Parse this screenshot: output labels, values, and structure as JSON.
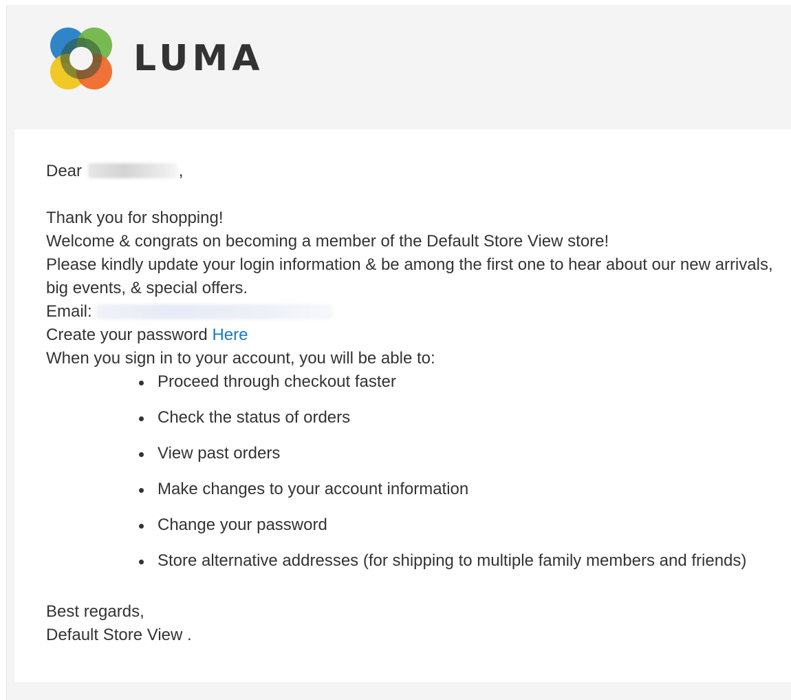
{
  "header": {
    "logo_text": "LUMA",
    "logo_colors": [
      "#1979c3",
      "#6cb33f",
      "#f1c40f",
      "#f26322",
      "#333333"
    ]
  },
  "email": {
    "greeting_prefix": "Dear",
    "greeting_suffix": ",",
    "lines": {
      "thanks": "Thank you for shopping!",
      "welcome": "Welcome & congrats on becoming a member of the Default Store View store!",
      "update": "Please kindly update your login information & be among the first one to hear about our new arrivals, big events, & special offers.",
      "email_label": "Email:",
      "create_password": "Create your password",
      "create_password_link": "Here",
      "sign_in_intro": "When you sign in to your account, you will be able to:"
    },
    "benefits": [
      "Proceed through checkout faster",
      "Check the status of orders",
      "View past orders",
      "Make changes to your account information",
      "Change your password",
      "Store alternative addresses (for shipping to multiple family members and friends)"
    ],
    "closing": "Best regards,",
    "signature": "Default Store View ."
  },
  "colors": {
    "link": "#1979c3",
    "text": "#333333",
    "header_bg": "#f4f4f4"
  }
}
